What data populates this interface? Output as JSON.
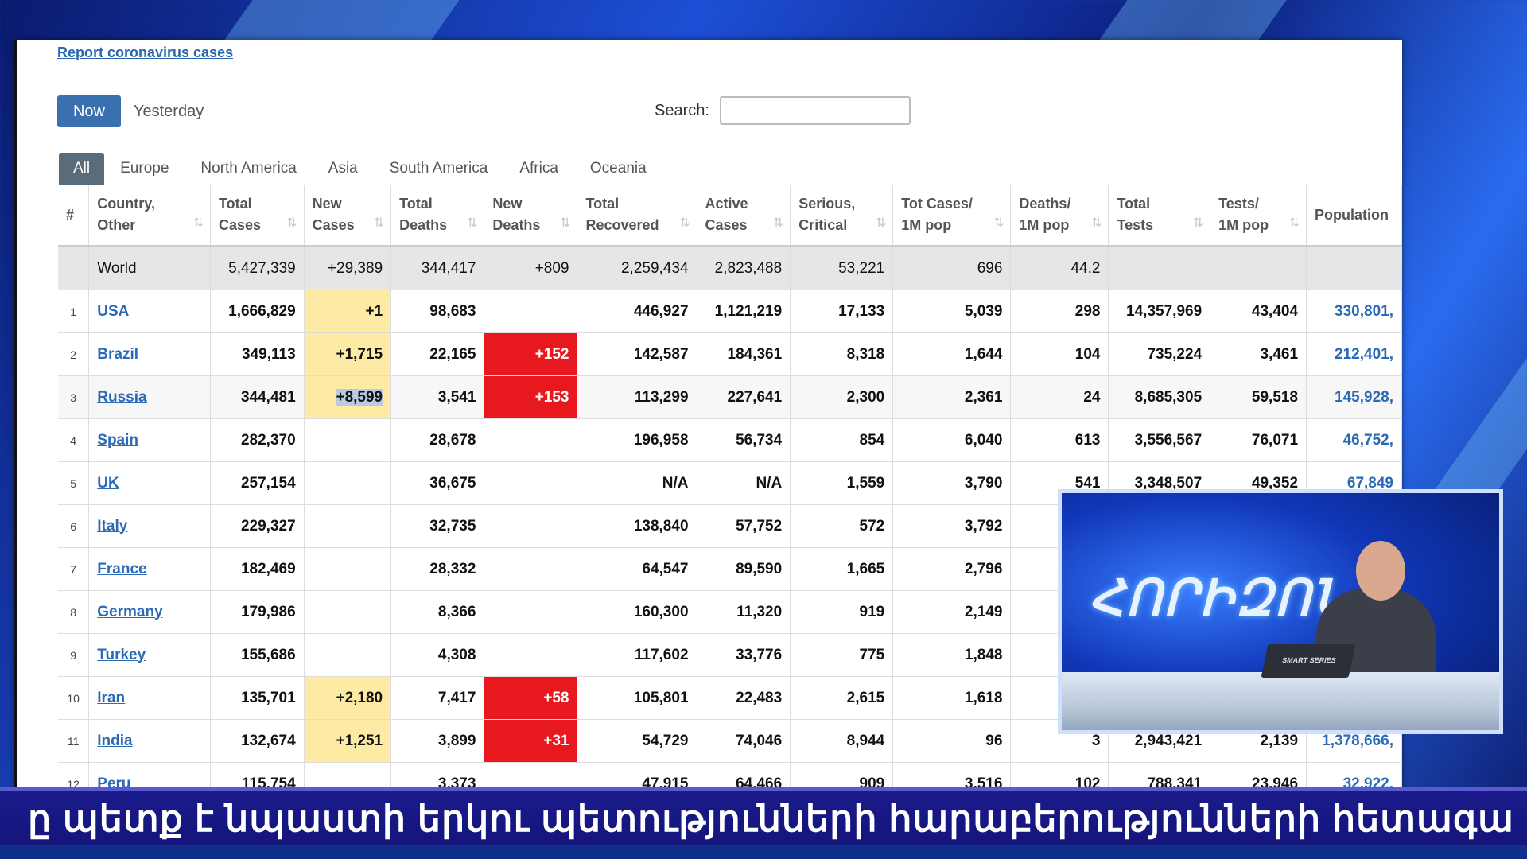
{
  "page": {
    "report_link": "Report coronavirus cases",
    "now_label": "Now",
    "yesterday_label": "Yesterday",
    "search_label": "Search:",
    "search_value": "",
    "regions": [
      "All",
      "Europe",
      "North America",
      "Asia",
      "South America",
      "Africa",
      "Oceania"
    ]
  },
  "table": {
    "headers": [
      {
        "l1": "#",
        "l2": ""
      },
      {
        "l1": "Country,",
        "l2": "Other"
      },
      {
        "l1": "Total",
        "l2": "Cases"
      },
      {
        "l1": "New",
        "l2": "Cases"
      },
      {
        "l1": "Total",
        "l2": "Deaths"
      },
      {
        "l1": "New",
        "l2": "Deaths"
      },
      {
        "l1": "Total",
        "l2": "Recovered"
      },
      {
        "l1": "Active",
        "l2": "Cases"
      },
      {
        "l1": "Serious,",
        "l2": "Critical"
      },
      {
        "l1": "Tot Cases/",
        "l2": "1M pop"
      },
      {
        "l1": "Deaths/",
        "l2": "1M pop"
      },
      {
        "l1": "Total",
        "l2": "Tests"
      },
      {
        "l1": "Tests/",
        "l2": "1M pop"
      },
      {
        "l1": "Population",
        "l2": ""
      }
    ],
    "world": [
      "",
      "World",
      "5,427,339",
      "+29,389",
      "344,417",
      "+809",
      "2,259,434",
      "2,823,488",
      "53,221",
      "696",
      "44.2",
      "",
      "",
      ""
    ],
    "rows": [
      [
        "1",
        "USA",
        "1,666,829",
        "+1",
        "98,683",
        "",
        "446,927",
        "1,121,219",
        "17,133",
        "5,039",
        "298",
        "14,357,969",
        "43,404",
        "330,801,"
      ],
      [
        "2",
        "Brazil",
        "349,113",
        "+1,715",
        "22,165",
        "+152",
        "142,587",
        "184,361",
        "8,318",
        "1,644",
        "104",
        "735,224",
        "3,461",
        "212,401,"
      ],
      [
        "3",
        "Russia",
        "344,481",
        "+8,599",
        "3,541",
        "+153",
        "113,299",
        "227,641",
        "2,300",
        "2,361",
        "24",
        "8,685,305",
        "59,518",
        "145,928,"
      ],
      [
        "4",
        "Spain",
        "282,370",
        "",
        "28,678",
        "",
        "196,958",
        "56,734",
        "854",
        "6,040",
        "613",
        "3,556,567",
        "76,071",
        "46,752,"
      ],
      [
        "5",
        "UK",
        "257,154",
        "",
        "36,675",
        "",
        "N/A",
        "N/A",
        "1,559",
        "3,790",
        "541",
        "3,348,507",
        "49,352",
        "67,849"
      ],
      [
        "6",
        "Italy",
        "229,327",
        "",
        "32,735",
        "",
        "138,840",
        "57,752",
        "572",
        "3,792",
        "",
        "",
        "",
        ""
      ],
      [
        "7",
        "France",
        "182,469",
        "",
        "28,332",
        "",
        "64,547",
        "89,590",
        "1,665",
        "2,796",
        "",
        "",
        "",
        ""
      ],
      [
        "8",
        "Germany",
        "179,986",
        "",
        "8,366",
        "",
        "160,300",
        "11,320",
        "919",
        "2,149",
        "",
        "",
        "",
        ""
      ],
      [
        "9",
        "Turkey",
        "155,686",
        "",
        "4,308",
        "",
        "117,602",
        "33,776",
        "775",
        "1,848",
        "",
        "",
        "",
        ""
      ],
      [
        "10",
        "Iran",
        "135,701",
        "+2,180",
        "7,417",
        "+58",
        "105,801",
        "22,483",
        "2,615",
        "1,618",
        "",
        "",
        "",
        ""
      ],
      [
        "11",
        "India",
        "132,674",
        "+1,251",
        "3,899",
        "+31",
        "54,729",
        "74,046",
        "8,944",
        "96",
        "3",
        "2,943,421",
        "2,139",
        "1,378,666,"
      ],
      [
        "12",
        "Peru",
        "115,754",
        "",
        "3,373",
        "",
        "47,915",
        "64,466",
        "909",
        "3,516",
        "102",
        "788,341",
        "23,946",
        "32,922,"
      ]
    ]
  },
  "inset": {
    "logo_text": "ՀՈՐԻԶՈՆ",
    "laptop_label": "SMART SERIES"
  },
  "ticker": {
    "text": "ը պետք է նպաստի երկու պետությունների հարաբերությունների հետագա բարելավմանը: Ինչ վեր"
  },
  "colors": {
    "link": "#2a6ab6",
    "now_button": "#3a6fb0",
    "new_cases_bg": "#fdeaa4",
    "new_deaths_bg": "#e8191e",
    "ticker_bg": "#1b1b8c"
  }
}
